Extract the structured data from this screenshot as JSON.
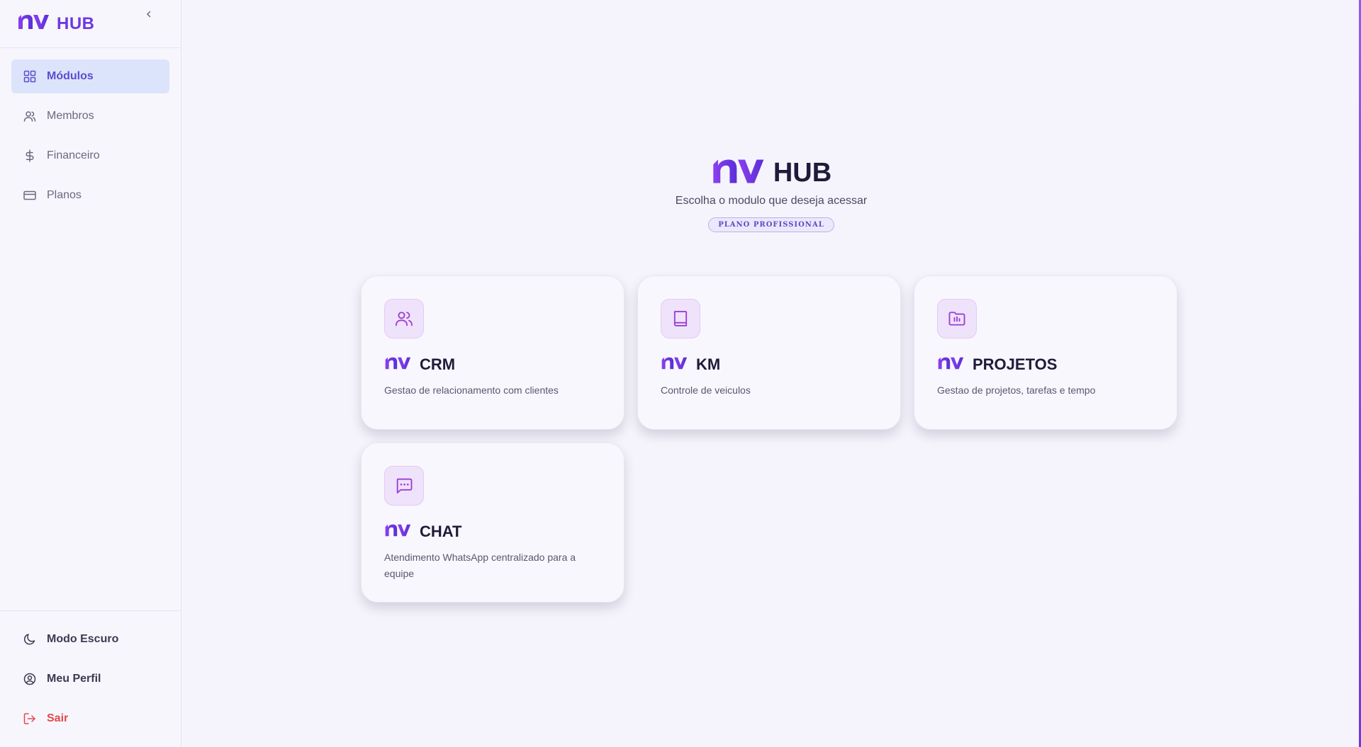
{
  "sidebar": {
    "brand": "HUB",
    "nav": [
      {
        "label": "Módulos",
        "icon": "grid-icon",
        "active": true
      },
      {
        "label": "Membros",
        "icon": "users-icon"
      },
      {
        "label": "Financeiro",
        "icon": "dollar-icon"
      },
      {
        "label": "Planos",
        "icon": "credit-card-icon"
      }
    ],
    "bottom": [
      {
        "label": "Modo Escuro",
        "icon": "moon-icon"
      },
      {
        "label": "Meu Perfil",
        "icon": "user-circle-icon"
      },
      {
        "label": "Sair",
        "icon": "logout-icon"
      }
    ]
  },
  "hero": {
    "brand": "HUB",
    "subtitle": "Escolha o modulo que deseja acessar",
    "badge": "PLANO PROFISSIONAL"
  },
  "modules": [
    {
      "name": "CRM",
      "description": "Gestao de relacionamento com clientes",
      "icon": "users-icon"
    },
    {
      "name": "KM",
      "description": "Controle de veiculos",
      "icon": "book-icon"
    },
    {
      "name": "PROJETOS",
      "description": "Gestao de projetos, tarefas e tempo",
      "icon": "folder-chart-icon"
    },
    {
      "name": "CHAT",
      "description": "Atendimento WhatsApp centralizado para a equipe",
      "icon": "message-icon"
    }
  ],
  "colors": {
    "accent": "#6d3ae0",
    "active_bg": "#dce4fb",
    "danger": "#e5484d",
    "background": "#f5f4fc"
  }
}
